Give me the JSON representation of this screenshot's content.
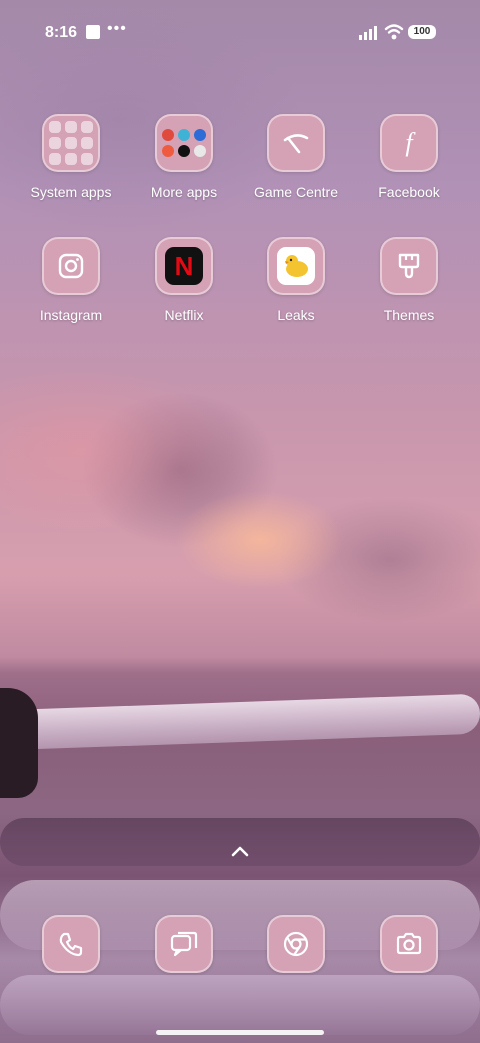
{
  "status": {
    "time": "8:16",
    "dots": "•••",
    "battery": "100"
  },
  "apps": [
    {
      "label": "System apps",
      "icon": "folder-icon"
    },
    {
      "label": "More apps",
      "icon": "folder-icon"
    },
    {
      "label": "Game Centre",
      "icon": "game-centre-icon"
    },
    {
      "label": "Facebook",
      "icon": "facebook-icon"
    },
    {
      "label": "Instagram",
      "icon": "instagram-icon"
    },
    {
      "label": "Netflix",
      "icon": "netflix-icon"
    },
    {
      "label": "Leaks",
      "icon": "leaks-icon"
    },
    {
      "label": "Themes",
      "icon": "brush-icon"
    }
  ],
  "dock": [
    {
      "icon": "phone-icon"
    },
    {
      "icon": "messages-icon"
    },
    {
      "icon": "chrome-icon"
    },
    {
      "icon": "camera-icon"
    }
  ],
  "colors": {
    "tile": "#d4a1b5",
    "netflix_red": "#e50914"
  }
}
